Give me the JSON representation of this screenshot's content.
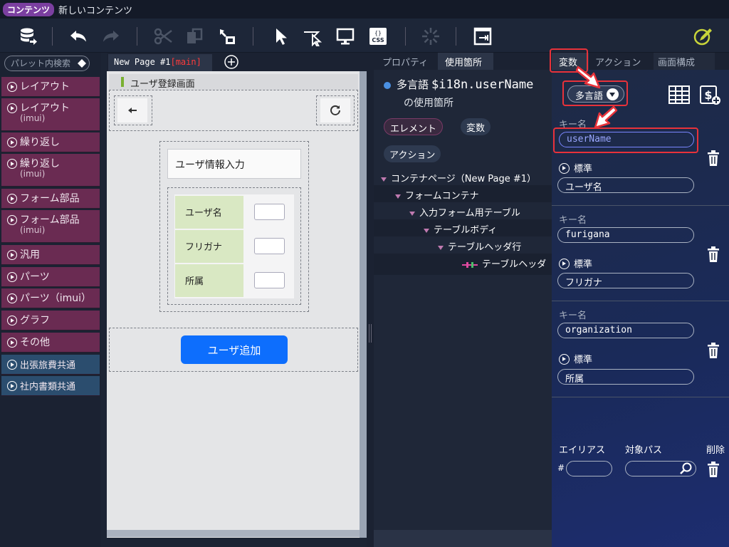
{
  "window": {
    "badge": "コンテンツ",
    "title": "新しいコンテンツ"
  },
  "colors": {
    "palette_item": "#6a2b52",
    "palette_item_blue": "#2b4d6e",
    "primary_button": "#0d6efd",
    "highlight": "#e8323a",
    "form_label_bg": "#d9e8c3"
  },
  "toolbar": {
    "icons": [
      "database-export-icon",
      "undo-icon",
      "redo-icon",
      "cut-icon",
      "paste-icon",
      "move-icon",
      "select-pointer-icon",
      "pointer-outline-icon",
      "monitor-icon",
      "css-icon",
      "loading-icon",
      "export-icon",
      "edit-pen-icon"
    ],
    "css_label": "CSS"
  },
  "palette": {
    "search_placeholder": "パレット内検索",
    "items": [
      {
        "label": "レイアウト",
        "sub": ""
      },
      {
        "label": "レイアウト",
        "sub": "(imui)"
      },
      {
        "label": "繰り返し",
        "sub": ""
      },
      {
        "label": "繰り返し",
        "sub": "(imui)"
      },
      {
        "label": "フォーム部品",
        "sub": ""
      },
      {
        "label": "フォーム部品",
        "sub": "(imui)"
      },
      {
        "label": "汎用",
        "sub": ""
      },
      {
        "label": "パーツ",
        "sub": ""
      },
      {
        "label": "パーツ（imui）",
        "sub": ""
      },
      {
        "label": "グラフ",
        "sub": ""
      },
      {
        "label": "その他",
        "sub": ""
      },
      {
        "label": "出張旅費共通",
        "sub": ""
      },
      {
        "label": "社内書類共通",
        "sub": ""
      }
    ]
  },
  "editor": {
    "tab": {
      "name": "New Page #1",
      "scope": "[main]"
    },
    "screen_title": "ユーザ登録画面",
    "card_title": "ユーザ情報入力",
    "form_rows": [
      "ユーザ名",
      "フリガナ",
      "所属"
    ],
    "add_button": "ユーザ追加"
  },
  "usage": {
    "tabs": [
      "プロパティ",
      "使用箇所"
    ],
    "active_tab": "使用箇所",
    "heading_prefix": "多言語",
    "heading_var": "$i18n.userName",
    "heading_sub": "の使用箇所",
    "chips": [
      "エレメント",
      "変数",
      "アクション"
    ],
    "tree": [
      {
        "label": "コンテナページ（New Page #1）",
        "level": 0
      },
      {
        "label": "フォームコンテナ",
        "level": 1
      },
      {
        "label": "入力フォーム用テーブル",
        "level": 2
      },
      {
        "label": "テーブルボディ",
        "level": 3
      },
      {
        "label": "テーブルヘッダ行",
        "level": 4
      },
      {
        "label": "テーブルヘッダ",
        "level": 5
      }
    ]
  },
  "variables": {
    "tabs": [
      "変数",
      "アクション",
      "画面構成"
    ],
    "active_tab": "変数",
    "selector": "多言語",
    "key_label": "キー名",
    "standard_label": "標準",
    "entries": [
      {
        "key": "userName",
        "standard": "ユーザ名"
      },
      {
        "key": "furigana",
        "standard": "フリガナ"
      },
      {
        "key": "organization",
        "standard": "所属"
      }
    ],
    "alias_header": {
      "alias": "エイリアス",
      "path": "対象パス",
      "delete": "削除"
    },
    "alias_prefix": "#"
  }
}
